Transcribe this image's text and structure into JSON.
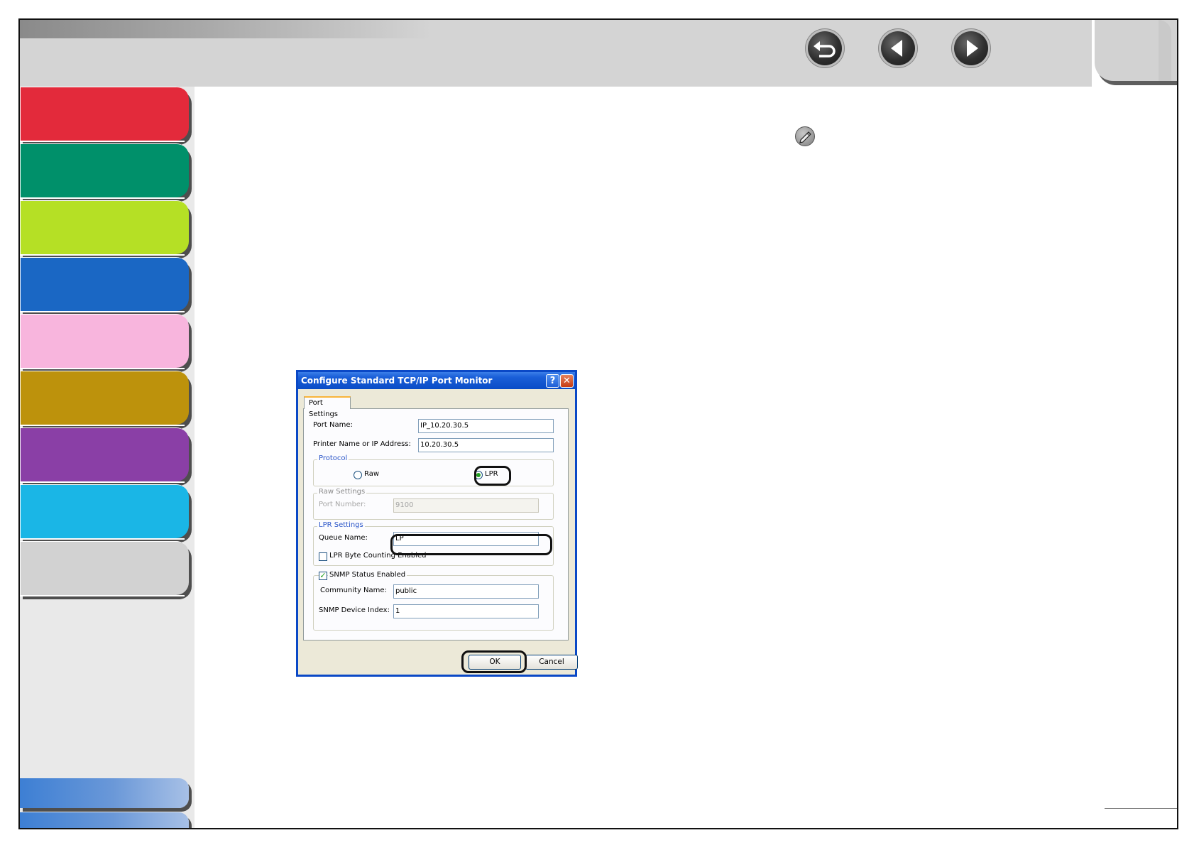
{
  "nav": {
    "icons": [
      "back-icon",
      "previous-page-icon",
      "next-page-icon"
    ]
  },
  "sidebar": {
    "tab_colors": [
      "#e32a3b",
      "#00906a",
      "#b5e025",
      "#1a67c4",
      "#f8b5dd",
      "#bd920c",
      "#8a3fa6",
      "#1ab6e6",
      "#d2d2d2"
    ]
  },
  "dialog": {
    "title": "Configure Standard TCP/IP Port Monitor",
    "help_label": "?",
    "close_label": "✕",
    "tab_label": "Port Settings",
    "port_name_label": "Port Name:",
    "port_name_value": "IP_10.20.30.5",
    "printer_label": "Printer Name or IP Address:",
    "printer_value": "10.20.30.5",
    "protocol": {
      "title": "Protocol",
      "raw_label": "Raw",
      "lpr_label": "LPR",
      "selected": "LPR"
    },
    "raw_settings": {
      "title": "Raw Settings",
      "port_number_label": "Port Number:",
      "port_number_value": "9100"
    },
    "lpr_settings": {
      "title": "LPR Settings",
      "queue_label": "Queue Name:",
      "queue_value": "LP",
      "byte_counting_label": "LPR Byte Counting Enabled",
      "byte_counting_checked": false
    },
    "snmp": {
      "enabled_label": "SNMP Status Enabled",
      "enabled_checked": true,
      "community_label": "Community Name:",
      "community_value": "public",
      "device_index_label": "SNMP Device Index:",
      "device_index_value": "1"
    },
    "ok_label": "OK",
    "cancel_label": "Cancel"
  }
}
